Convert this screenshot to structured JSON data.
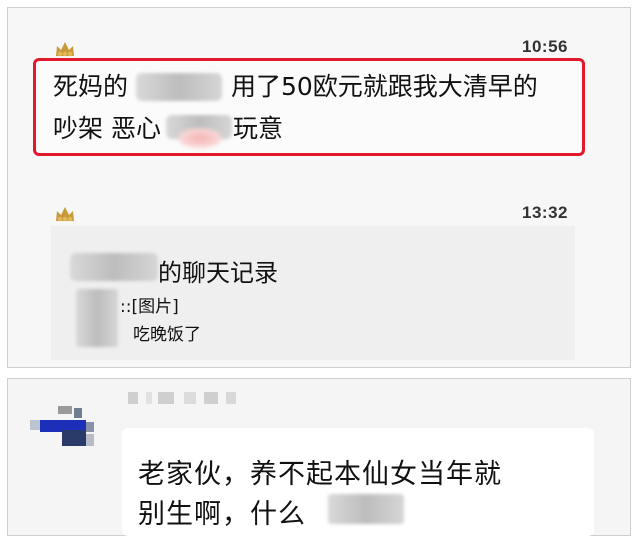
{
  "messages": [
    {
      "time": "10:56",
      "line1_a": "死妈的",
      "line1_b": "用了50欧元就跟我大清早的",
      "line2_a": "吵架 恶心",
      "line2_b": "玩意"
    },
    {
      "time": "13:32",
      "record_title_suffix": "的聊天记录",
      "record_item1": "::[图片]",
      "record_item2": "吃晚饭了"
    }
  ],
  "reply": {
    "line1": "老家伙，养不起本仙女当年就",
    "line2": "别生啊，什么"
  },
  "colors": {
    "highlight_border": "#e0192b",
    "panel_bg": "#f7f7f7"
  }
}
